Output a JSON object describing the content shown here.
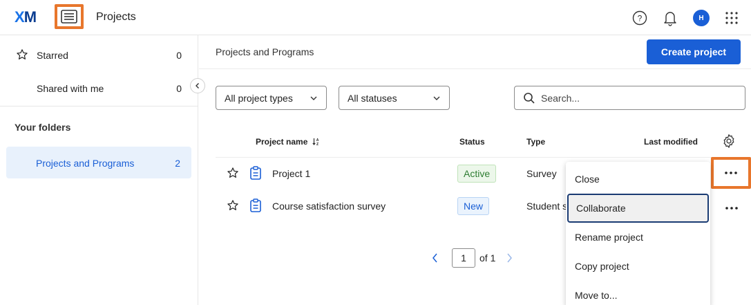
{
  "app": {
    "logo_text_x": "X",
    "logo_text_m": "M",
    "title": "Projects"
  },
  "topbar_icons": [
    "menu-icon",
    "help-icon",
    "bell-icon",
    "avatar",
    "apps-grid-icon"
  ],
  "user": {
    "initial": "H"
  },
  "sidebar": {
    "items": [
      {
        "label": "Starred",
        "count": "0",
        "icon": "star-icon"
      },
      {
        "label": "Shared with me",
        "count": "0"
      }
    ],
    "folders_heading": "Your folders",
    "folders": [
      {
        "label": "Projects and Programs",
        "count": "2"
      }
    ]
  },
  "main": {
    "breadcrumb": "Projects and Programs",
    "create_label": "Create project",
    "filters": {
      "types": "All project types",
      "statuses": "All statuses"
    },
    "search": {
      "placeholder": "Search..."
    },
    "columns": {
      "name": "Project name",
      "status": "Status",
      "type": "Type",
      "modified": "Last modified"
    },
    "rows": [
      {
        "name": "Project 1",
        "status": "Active",
        "type": "Survey"
      },
      {
        "name": "Course satisfaction survey",
        "status": "New",
        "type": "Student s"
      }
    ],
    "pager": {
      "page": "1",
      "of_label": "of 1"
    }
  },
  "menu": {
    "items": [
      "Close",
      "Collaborate",
      "Rename project",
      "Copy project",
      "Move to..."
    ]
  },
  "colors": {
    "accent": "#1a5fd6",
    "highlight": "#e8762c",
    "active_status": "#2e7d32"
  }
}
